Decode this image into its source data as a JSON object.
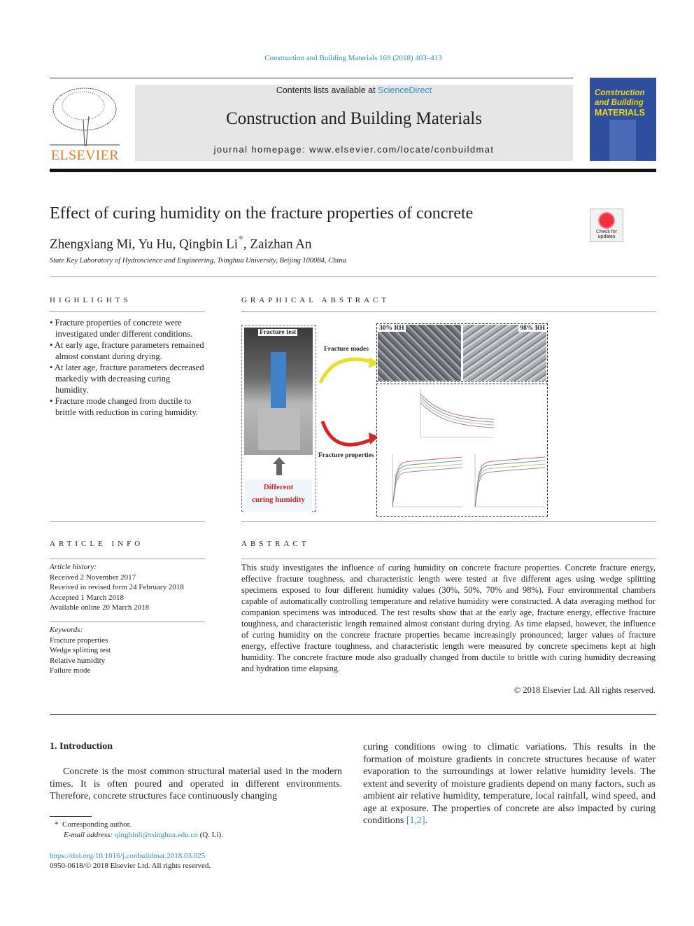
{
  "journal_ref": "Construction and Building Materials 169 (2018) 403–413",
  "banner": {
    "contents_prefix": "Contents lists available at ",
    "contents_link": "ScienceDirect",
    "journal_name": "Construction and Building Materials",
    "homepage": "journal homepage: www.elsevier.com/locate/conbuildmat"
  },
  "publisher_logo": "ELSEVIER",
  "cover": {
    "line1": "Construction",
    "line2": "and Building",
    "line3": "MATERIALS"
  },
  "check_updates": "Check for updates",
  "article": {
    "title": "Effect of curing humidity on the fracture properties of concrete",
    "authors_a": "Zhengxiang Mi, Yu Hu, Qingbin Li",
    "author_mark": "*",
    "authors_b": ", Zaizhan An",
    "affiliation": "State Key Laboratory of Hydroscience and Engineering, Tsinghua University, Beijing 100084, China"
  },
  "highlights": {
    "heading": "HIGHLIGHTS",
    "items": [
      "Fracture properties of concrete were investigated under different conditions.",
      "At early age, fracture parameters remained almost constant during drying.",
      "At later age, fracture parameters decreased markedly with decreasing curing humidity.",
      "Fracture mode changed from ductile to brittle with reduction in curing humidity."
    ]
  },
  "graphical_abstract": {
    "heading": "GRAPHICAL ABSTRACT",
    "fracture_test": "Fracture test",
    "fracture_modes": "Fracture modes",
    "fracture_properties": "Fracture properties",
    "rh_low": "30% RH",
    "rh_high": "98% RH",
    "diff1": "Different",
    "diff2": "curing humidity",
    "colors": {
      "series": [
        "#e04040",
        "#3a7fd0",
        "#a0c040",
        "#8a5ec8"
      ]
    }
  },
  "article_info": {
    "heading": "ARTICLE INFO",
    "history_label": "Article history:",
    "history": [
      "Received 2 November 2017",
      "Received in revised form 24 February 2018",
      "Accepted 1 March 2018",
      "Available online 20 March 2018"
    ],
    "keywords_label": "Keywords:",
    "keywords": [
      "Fracture properties",
      "Wedge splitting test",
      "Relative humidity",
      "Failure mode"
    ]
  },
  "abstract": {
    "heading": "ABSTRACT",
    "text": "This study investigates the influence of curing humidity on concrete fracture properties. Concrete fracture energy, effective fracture toughness, and characteristic length were tested at five different ages using wedge splitting specimens exposed to four different humidity values (30%, 50%, 70% and 98%). Four environmental chambers capable of automatically controlling temperature and relative humidity were constructed. A data averaging method for companion specimens was introduced. The test results show that at the early age, fracture energy, effective fracture toughness, and characteristic length remained almost constant during drying. As time elapsed, however, the influence of curing humidity on the concrete fracture properties became increasingly pronounced; larger values of fracture energy, effective fracture toughness, and characteristic length were measured by concrete specimens kept at high humidity. The concrete fracture mode also gradually changed from ductile to brittle with curing humidity decreasing and hydration time elapsing.",
    "copyright": "© 2018 Elsevier Ltd. All rights reserved."
  },
  "intro": {
    "heading": "1. Introduction",
    "col1": "Concrete is the most common structural material used in the modern times. It is often poured and operated in different environments. Therefore, concrete structures face continuously changing",
    "col2": "curing conditions owing to climatic variations. This results in the formation of moisture gradients in concrete structures because of water evaporation to the surroundings at lower relative humidity levels. The extent and severity of moisture gradients depend on many factors, such as ambient air relative humidity, temperature, local rainfall, wind speed, and age at exposure. The properties of concrete are also impacted by curing conditions ",
    "col2_ref": "[1,2]",
    "col2_end": "."
  },
  "footnote": {
    "mark": "*",
    "corresponding": "Corresponding author.",
    "email_label": "E-mail address:",
    "email": "qingbinli@tsinghua.edu.cn",
    "email_suffix": " (Q. Li)."
  },
  "doi": "https://doi.org/10.1016/j.conbuildmat.2018.03.025",
  "issn": "0950-0618/© 2018 Elsevier Ltd. All rights reserved."
}
